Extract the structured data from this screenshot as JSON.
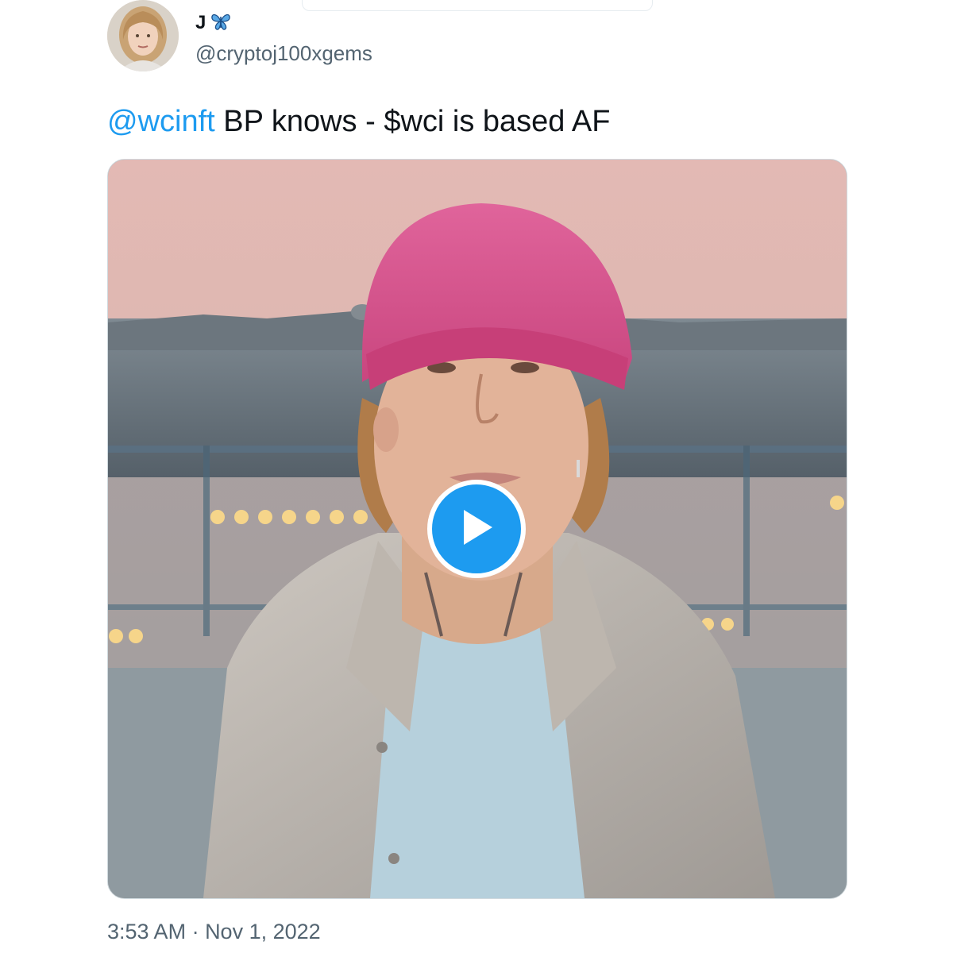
{
  "tweet": {
    "author": {
      "display_name": "J",
      "badge_icon": "butterfly-emoji-icon",
      "handle": "@cryptoj100xgems"
    },
    "text": {
      "mention": "@wcinft",
      "body": " BP knows - $wci is based AF"
    },
    "media": {
      "type": "video",
      "play_icon": "play-icon"
    },
    "timestamp": {
      "time": "3:53 AM",
      "separator": " · ",
      "date": "Nov 1, 2022"
    }
  },
  "colors": {
    "mention": "#1d9bf0",
    "play_button": "#1d9bf0",
    "text_primary": "#0f1419",
    "text_secondary": "#536471"
  }
}
